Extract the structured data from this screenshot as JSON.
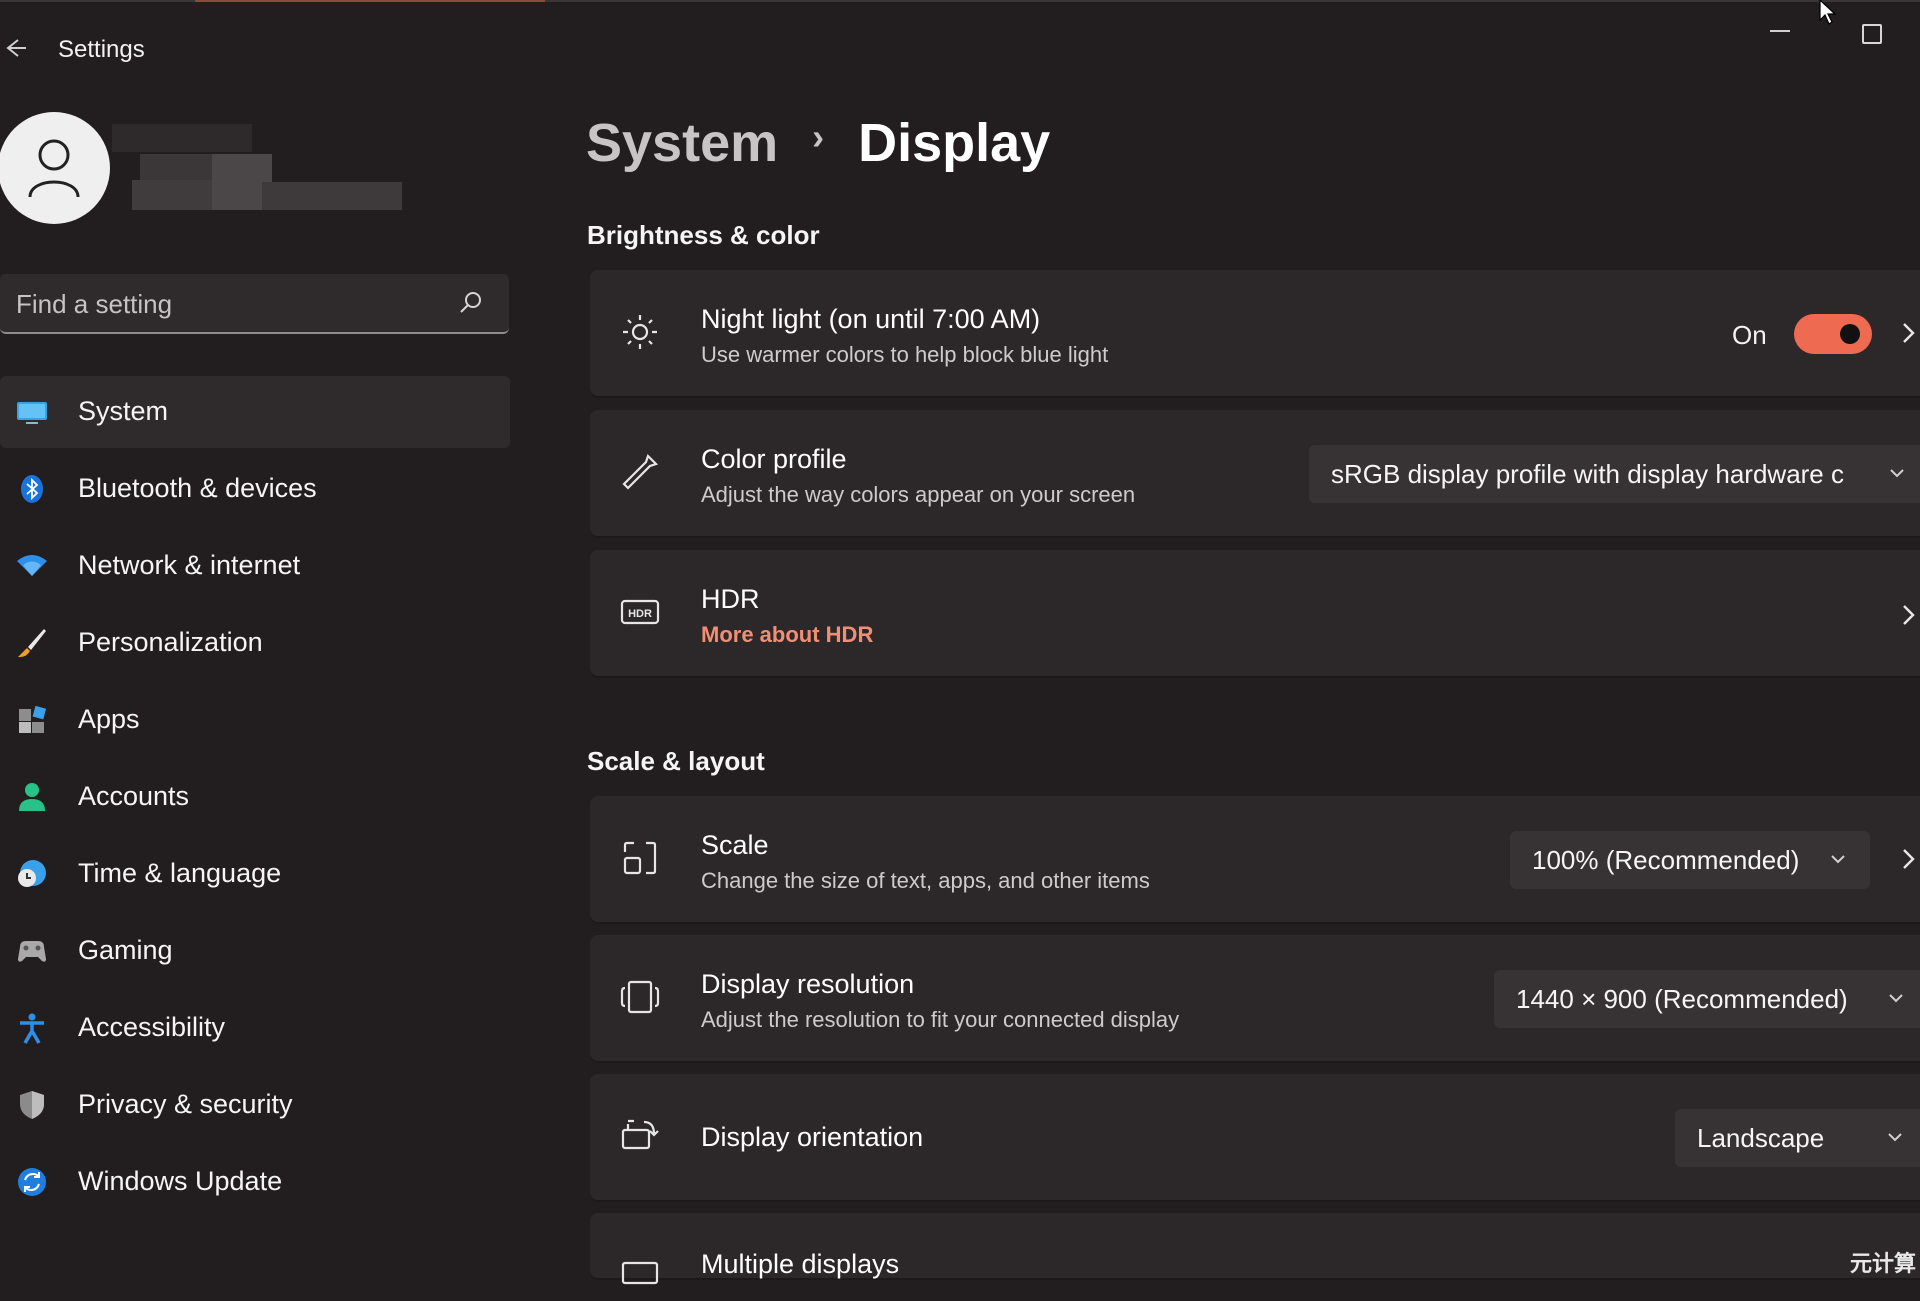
{
  "window": {
    "title": "Settings"
  },
  "search": {
    "placeholder": "Find a setting"
  },
  "sidebar": {
    "items": [
      {
        "label": "System",
        "icon": "monitor-icon",
        "selected": true
      },
      {
        "label": "Bluetooth & devices",
        "icon": "bluetooth-icon"
      },
      {
        "label": "Network & internet",
        "icon": "wifi-icon"
      },
      {
        "label": "Personalization",
        "icon": "brush-icon"
      },
      {
        "label": "Apps",
        "icon": "apps-icon"
      },
      {
        "label": "Accounts",
        "icon": "person-icon"
      },
      {
        "label": "Time & language",
        "icon": "globe-clock-icon"
      },
      {
        "label": "Gaming",
        "icon": "gamepad-icon"
      },
      {
        "label": "Accessibility",
        "icon": "accessibility-icon"
      },
      {
        "label": "Privacy & security",
        "icon": "shield-icon"
      },
      {
        "label": "Windows Update",
        "icon": "update-icon"
      }
    ]
  },
  "breadcrumb": {
    "parent": "System",
    "separator": "›",
    "current": "Display"
  },
  "sections": {
    "brightness": {
      "title": "Brightness & color",
      "night_light": {
        "title": "Night light (on until 7:00 AM)",
        "desc": "Use warmer colors to help block blue light",
        "toggle_label": "On",
        "toggle_on": true
      },
      "color_profile": {
        "title": "Color profile",
        "desc": "Adjust the way colors appear on your screen",
        "value": "sRGB display profile with display hardware c"
      },
      "hdr": {
        "title": "HDR",
        "link": "More about HDR"
      }
    },
    "scale_layout": {
      "title": "Scale & layout",
      "scale": {
        "title": "Scale",
        "desc": "Change the size of text, apps, and other items",
        "value": "100% (Recommended)"
      },
      "resolution": {
        "title": "Display resolution",
        "desc": "Adjust the resolution to fit your connected display",
        "value": "1440 × 900 (Recommended)"
      },
      "orientation": {
        "title": "Display orientation",
        "value": "Landscape"
      },
      "multiple": {
        "title": "Multiple displays"
      }
    }
  },
  "colors": {
    "accent": "#ee6a51",
    "link": "#f08f73",
    "background": "#221d1f",
    "card": "#2c2729"
  }
}
